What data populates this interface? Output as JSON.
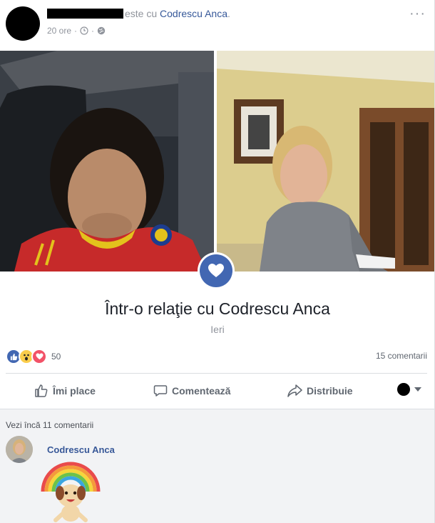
{
  "post": {
    "header_suffix": "este cu",
    "tagged_name": "Codrescu Anca",
    "header_end": ".",
    "timestamp": "20 ore",
    "separator": "·",
    "more_icon": "more-horizontal-icon"
  },
  "relationship": {
    "title": "Într-o relaţie cu Codrescu Anca",
    "date": "Ieri",
    "badge_icon": "heart-icon"
  },
  "stats": {
    "reaction_icons": [
      "like-icon",
      "wow-icon",
      "love-icon"
    ],
    "reaction_count": "50",
    "comments": "15 comentarii"
  },
  "actions": {
    "like": "Îmi place",
    "comment": "Comentează",
    "share": "Distribuie"
  },
  "comments": {
    "view_more": "Vezi încă 11 comentarii",
    "first_author": "Codrescu Anca"
  },
  "colors": {
    "brand": "#4267b2",
    "link": "#365899",
    "love": "#f25268",
    "wow": "#fbcd4b"
  }
}
